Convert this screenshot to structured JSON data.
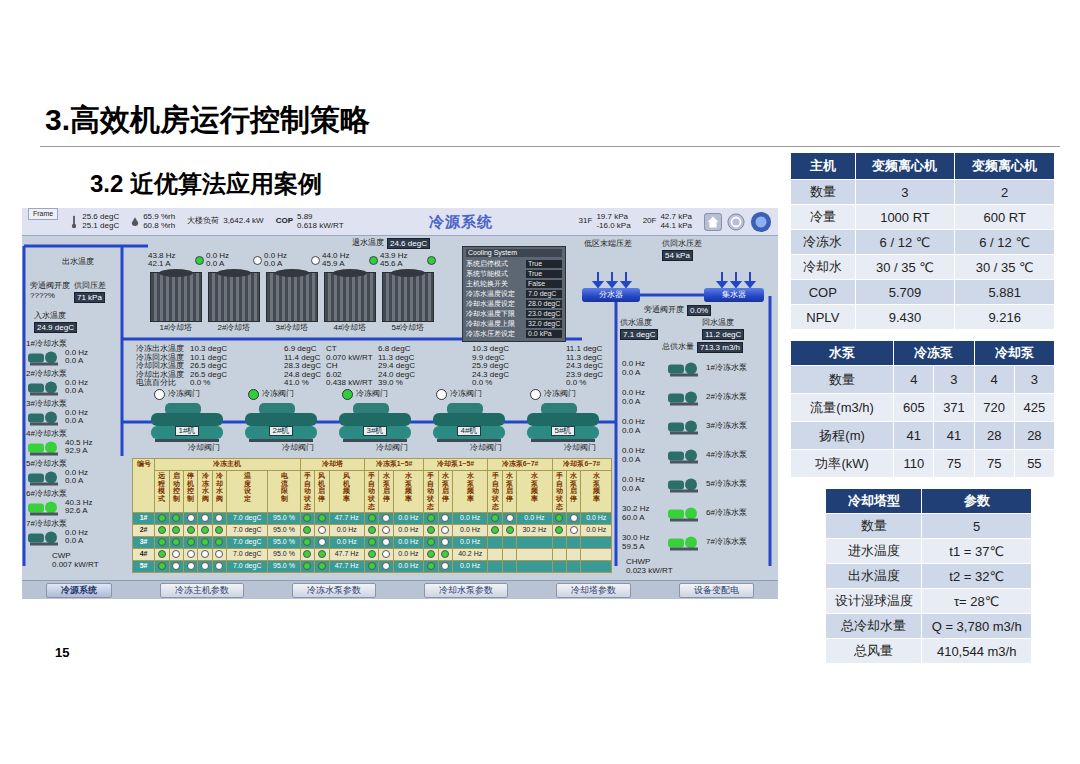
{
  "slide": {
    "title": "3.高效机房运行控制策略",
    "subtitle": "3.2 近优算法应用案例",
    "page_number": "15"
  },
  "scada": {
    "frame_tab": "Frame",
    "header": {
      "temperature": [
        "25.6 degC",
        "25.1 degC"
      ],
      "humidity": [
        "65.9 %rh",
        "60.8 %rh"
      ],
      "load_label": "大楼负荷",
      "load_value": "3,642.4 kW",
      "cop_label": "COP",
      "cop_values": [
        "5.89",
        "0.618 kW/RT"
      ],
      "title": "冷源系统",
      "floors": [
        {
          "floor": "31F",
          "values": [
            "19.7 kPa",
            "-16.0 kPa"
          ]
        },
        {
          "floor": "20F",
          "values": [
            "42.7 kPa",
            "44.1 kPa"
          ]
        }
      ]
    },
    "cooling_towers": [
      {
        "label": "1#冷却塔",
        "readings": [
          "43.8 Hz",
          "42.1 A"
        ],
        "running": true
      },
      {
        "label": "2#冷却塔",
        "readings": [
          "0.0 Hz",
          "0.0 A"
        ],
        "running": false
      },
      {
        "label": "3#冷却塔",
        "readings": [
          "0.0 Hz",
          "0.0 A"
        ],
        "running": false
      },
      {
        "label": "4#冷却塔",
        "readings": [
          "44.0 Hz",
          "45.9 A"
        ],
        "running": true
      },
      {
        "label": "5#冷却塔",
        "readings": [
          "43.9 Hz",
          "45.6 A"
        ],
        "running": true
      }
    ],
    "tower_return": {
      "label": "退水温度",
      "value": "24.6 degC"
    },
    "left_side": {
      "outlet_temp": "出水温度",
      "bypass_label": "旁通阀开度",
      "bypass_value": "????%",
      "dp_label": "供回压差",
      "dp_value": "71 kPa",
      "inlet_label": "入水温度",
      "inlet_value": "24.9 degC"
    },
    "cooling_pumps": [
      {
        "label": "1#冷却水泵",
        "readings": [
          "0.0 Hz",
          "0.0 A"
        ],
        "running": false
      },
      {
        "label": "2#冷却水泵",
        "readings": [
          "0.0 Hz",
          "0.0 A"
        ],
        "running": false
      },
      {
        "label": "3#冷却水泵",
        "readings": [
          "0.0 Hz",
          "0.0 A"
        ],
        "running": false
      },
      {
        "label": "4#冷却水泵",
        "readings": [
          "40.5 Hz",
          "92.9 A"
        ],
        "running": true
      },
      {
        "label": "5#冷却水泵",
        "readings": [
          "0.0 Hz",
          "0.0 A"
        ],
        "running": false
      },
      {
        "label": "6#冷却水泵",
        "readings": [
          "40.3 Hz",
          "92.6 A"
        ],
        "running": true
      },
      {
        "label": "7#冷却水泵",
        "readings": [
          "0.0 Hz",
          "0.0 A"
        ],
        "running": false
      }
    ],
    "cwp": [
      "CWP",
      "0.007 kW/RT"
    ],
    "chiller_reading_labels": [
      "冷冻出水温度",
      "冷冻回水温度",
      "冷却回水温度",
      "冷却出水温度",
      "电流百分比"
    ],
    "chillers": [
      {
        "label": "1#机",
        "readings": [
          "10.3 degC",
          "10.1 degC",
          "26.5 degC",
          "26.5 degC",
          "0.0 %"
        ],
        "valve_open": false,
        "valve_labels": [
          "冷冻阀门",
          "冷却阀门"
        ]
      },
      {
        "label": "2#机",
        "readings": [
          "6.9 degC",
          "11.4 degC",
          "28.3 degC",
          "24.8 degC",
          "41.0 %"
        ],
        "valve_open": true,
        "valve_labels": [
          "冷冻阀门",
          "冷却阀门"
        ]
      },
      {
        "label": "3#机",
        "readings": [
          "6.8 degC",
          "11.3 degC",
          "29.4 degC",
          "24.0 degC",
          "39.0 %"
        ],
        "valve_open": true,
        "valve_labels": [
          "冷冻阀门",
          "冷却阀门"
        ]
      },
      {
        "label": "4#机",
        "readings": [
          "10.3 degC",
          "9.9 degC",
          "25.9 degC",
          "24.3 degC",
          "0.0 %"
        ],
        "valve_open": false,
        "valve_labels": [
          "冷冻阀门",
          "冷却阀门"
        ]
      },
      {
        "label": "5#机",
        "readings": [
          "11.1 degC",
          "11.3 degC",
          "24.3 degC",
          "23.9 degC",
          "0.0 %"
        ],
        "valve_open": false,
        "valve_labels": [
          "冷冻阀门",
          "冷却阀门"
        ]
      }
    ],
    "chiller_totals": [
      "CT",
      "0.070 kW/RT",
      "CH",
      "6.02",
      "0.438 kW/RT"
    ],
    "control_panel": {
      "title": "Cooling System",
      "rows": [
        {
          "label": "系统启停模式",
          "value": "True"
        },
        {
          "label": "系统节能模式",
          "value": "True"
        },
        {
          "label": "主机轮换开关",
          "value": "False"
        },
        {
          "label": "冷冻水温度设定",
          "value": "7.0 degC"
        },
        {
          "label": "冷却水温度设定",
          "value": "28.0 degC"
        },
        {
          "label": "冷却水温度下限",
          "value": "23.0 degC"
        },
        {
          "label": "冷却水温度上限",
          "value": "32.0 degC"
        },
        {
          "label": "冷冻水压差设定",
          "value": "0.0 kPa"
        }
      ]
    },
    "right_side": {
      "low_zone_dp": "低区末端压差",
      "supply_return_dp": "供回水压差",
      "dp_value": "54 kPa",
      "supply_manifold": "分水器",
      "return_manifold": "集水器",
      "bypass_label": "旁通阀开度",
      "bypass_value": "0.0%",
      "supply_temp_label": "供水温度",
      "supply_temp_value": "7.1 degC",
      "return_temp_label": "回水温度",
      "return_temp_value": "11.2 degC",
      "flow_label": "总供水量",
      "flow_value": "713.3 m3/h"
    },
    "chilled_pumps": [
      {
        "label": "1#冷冻水泵",
        "readings": [
          "0.0 Hz",
          "0.0 A"
        ],
        "running": false
      },
      {
        "label": "2#冷冻水泵",
        "readings": [
          "0.0 Hz",
          "0.0 A"
        ],
        "running": false
      },
      {
        "label": "3#冷冻水泵",
        "readings": [
          "0.0 Hz",
          "0.0 A"
        ],
        "running": false
      },
      {
        "label": "4#冷冻水泵",
        "readings": [
          "0.0 Hz",
          "0.0 A"
        ],
        "running": false
      },
      {
        "label": "5#冷冻水泵",
        "readings": [
          "0.0 Hz",
          "0.0 A"
        ],
        "running": false
      },
      {
        "label": "6#冷冻水泵",
        "readings": [
          "30.2 Hz",
          "60.0 A"
        ],
        "running": true
      },
      {
        "label": "7#冷冻水泵",
        "readings": [
          "30.0 Hz",
          "59.5 A"
        ],
        "running": true
      }
    ],
    "chwp": [
      "CHWP",
      "0.023 kW/RT"
    ],
    "status_table": {
      "id_header": "编号",
      "groups": [
        {
          "name": "冷冻主机",
          "columns": [
            "远程模式",
            "启动控制",
            "停机控制",
            "冷冻水阀",
            "冷却水阀",
            "温度设定",
            "电流限制"
          ]
        },
        {
          "name": "冷却塔",
          "columns": [
            "手自动状态",
            "风机启停",
            "风机频率"
          ]
        },
        {
          "name": "冷冻泵1~5#",
          "columns": [
            "手自动状态",
            "水泵启停",
            "水泵频率"
          ]
        },
        {
          "name": "冷却泵1~5#",
          "columns": [
            "手自动状态",
            "水泵启停",
            "水泵频率"
          ]
        },
        {
          "name": "冷冻泵6~7#",
          "columns": [
            "手自动状态",
            "水泵启停",
            "水泵频率"
          ]
        },
        {
          "name": "冷却泵6~7#",
          "columns": [
            "手自动状态",
            "水泵启停",
            "水泵频率"
          ]
        }
      ],
      "rows": [
        {
          "id": "1#",
          "groups": [
            {
              "dots": [
                true,
                true,
                false,
                false,
                false
              ],
              "values": [
                "7.0 degC",
                "95.0 %"
              ]
            },
            {
              "dots": [
                true,
                true
              ],
              "values": [
                "47.7 Hz"
              ]
            },
            {
              "dots": [
                true,
                false
              ],
              "values": [
                "0.0 Hz"
              ]
            },
            {
              "dots": [
                true,
                false
              ],
              "values": [
                "0.0 Hz"
              ]
            },
            {
              "dots": [
                true,
                false
              ],
              "values": [
                "0.0 Hz"
              ]
            },
            {
              "dots": [
                true,
                false
              ],
              "values": [
                "0.0 Hz"
              ]
            }
          ]
        },
        {
          "id": "2#",
          "groups": [
            {
              "dots": [
                true,
                true,
                true,
                true,
                true
              ],
              "values": [
                "7.0 degC",
                "95.0 %"
              ]
            },
            {
              "dots": [
                true,
                false
              ],
              "values": [
                "0.0 Hz"
              ]
            },
            {
              "dots": [
                true,
                false
              ],
              "values": [
                "0.0 Hz"
              ]
            },
            {
              "dots": [
                true,
                false
              ],
              "values": [
                "0.0 Hz"
              ]
            },
            {
              "dots": [
                true,
                true
              ],
              "values": [
                "30.2 Hz"
              ]
            },
            {
              "dots": [
                true,
                false
              ],
              "values": [
                "0.0 Hz"
              ]
            }
          ]
        },
        {
          "id": "3#",
          "groups": [
            {
              "dots": [
                true,
                true,
                true,
                true,
                true
              ],
              "values": [
                "7.0 degC",
                "95.0 %"
              ]
            },
            {
              "dots": [
                true,
                false
              ],
              "values": [
                "0.0 Hz"
              ]
            },
            {
              "dots": [
                true,
                false
              ],
              "values": [
                "0.0 Hz"
              ]
            },
            {
              "dots": [
                true,
                false
              ],
              "values": [
                "0.0 Hz"
              ]
            },
            {
              "dots": [],
              "values": []
            },
            {
              "dots": [],
              "values": []
            }
          ]
        },
        {
          "id": "4#",
          "groups": [
            {
              "dots": [
                true,
                false,
                false,
                false,
                false
              ],
              "values": [
                "7.0 degC",
                "95.0 %"
              ]
            },
            {
              "dots": [
                true,
                true
              ],
              "values": [
                "47.7 Hz"
              ]
            },
            {
              "dots": [
                true,
                false
              ],
              "values": [
                "0.0 Hz"
              ]
            },
            {
              "dots": [
                true,
                true
              ],
              "values": [
                "40.2 Hz"
              ]
            },
            {
              "dots": [],
              "values": []
            },
            {
              "dots": [],
              "values": []
            }
          ]
        },
        {
          "id": "5#",
          "groups": [
            {
              "dots": [
                true,
                false,
                false,
                false,
                false
              ],
              "values": [
                "7.0 degC",
                "95.0 %"
              ]
            },
            {
              "dots": [
                true,
                true
              ],
              "values": [
                "47.7 Hz"
              ]
            },
            {
              "dots": [
                true,
                false
              ],
              "values": [
                "0.0 Hz"
              ]
            },
            {
              "dots": [
                true,
                false
              ],
              "values": [
                "0.0 Hz"
              ]
            },
            {
              "dots": [],
              "values": []
            },
            {
              "dots": [],
              "values": []
            }
          ]
        }
      ]
    },
    "nav": [
      {
        "label": "冷源系统",
        "selected": true
      },
      {
        "label": "冷冻主机参数",
        "selected": false
      },
      {
        "label": "冷冻水泵参数",
        "selected": false
      },
      {
        "label": "冷却水泵参数",
        "selected": false
      },
      {
        "label": "冷却塔参数",
        "selected": false
      },
      {
        "label": "设备变配电",
        "selected": false
      }
    ]
  },
  "chiller_spec_table": {
    "headers": [
      "主机",
      "变频离心机",
      "变频离心机"
    ],
    "rows": [
      [
        "数量",
        "3",
        "2"
      ],
      [
        "冷量",
        "1000 RT",
        "600 RT"
      ],
      [
        "冷冻水",
        "6 / 12 ℃",
        "6 / 12 ℃"
      ],
      [
        "冷却水",
        "30 / 35 ℃",
        "30 / 35 ℃"
      ],
      [
        "COP",
        "5.709",
        "5.881"
      ],
      [
        "NPLV",
        "9.430",
        "9.216"
      ]
    ]
  },
  "pump_spec_table": {
    "headers": [
      "水泵",
      "冷冻泵",
      "冷却泵"
    ],
    "rows": [
      [
        "数量",
        "4",
        "3",
        "4",
        "3"
      ],
      [
        "流量(m3/h)",
        "605",
        "371",
        "720",
        "425"
      ],
      [
        "扬程(m)",
        "41",
        "41",
        "28",
        "28"
      ],
      [
        "功率(kW)",
        "110",
        "75",
        "75",
        "55"
      ]
    ]
  },
  "tower_spec_table": {
    "headers": [
      "冷却塔型",
      "参数"
    ],
    "rows": [
      [
        "数量",
        "5"
      ],
      [
        "进水温度",
        "t1 = 37℃"
      ],
      [
        "出水温度",
        "t2 = 32℃"
      ],
      [
        "设计湿球温度",
        "τ= 28℃"
      ],
      [
        "总冷却水量",
        "Q = 3,780 m3/h"
      ],
      [
        "总风量",
        "410,544 m3/h"
      ]
    ]
  }
}
